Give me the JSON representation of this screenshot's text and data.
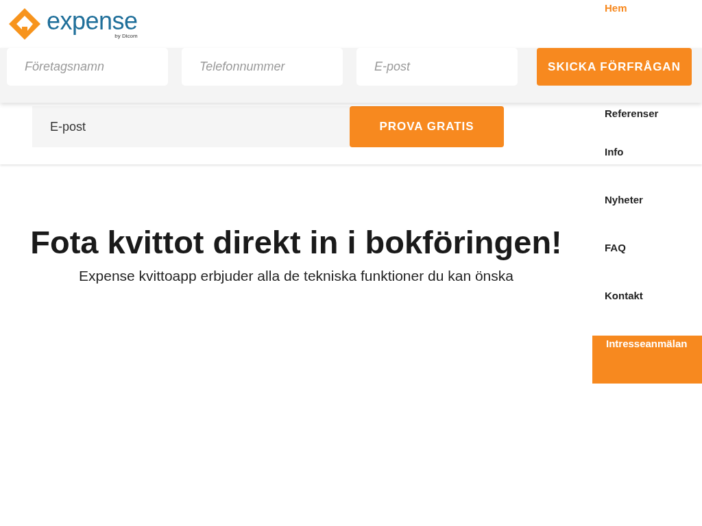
{
  "header": {
    "logo": {
      "name": "expense",
      "tagline": "by Dicom"
    }
  },
  "nav": {
    "items": [
      {
        "label": "Hem",
        "selected": true,
        "kind": "link"
      },
      {
        "label": "Referenser",
        "selected": false,
        "kind": "link"
      },
      {
        "label": "Info",
        "selected": false,
        "kind": "link"
      },
      {
        "label": "Nyheter",
        "selected": false,
        "kind": "link"
      },
      {
        "label": "FAQ",
        "selected": false,
        "kind": "link"
      },
      {
        "label": "Kontakt",
        "selected": false,
        "kind": "link"
      },
      {
        "label": "Intresseanmälan",
        "selected": false,
        "kind": "button"
      }
    ]
  },
  "request_form": {
    "fields": [
      {
        "placeholder": "Företagsnamn"
      },
      {
        "placeholder": "Telefonnummer"
      },
      {
        "placeholder": "E-post"
      }
    ],
    "button": "SKICKA FÖRFRÅGAN"
  },
  "trial_form": {
    "field": {
      "placeholder": "E-post"
    },
    "button": "PROVA GRATIS"
  },
  "hero": {
    "title": "Fota kvittot direkt in i bokföringen!",
    "subtitle": "Expense kvittoapp erbjuder alla de tekniska funktioner du kan önska"
  }
}
